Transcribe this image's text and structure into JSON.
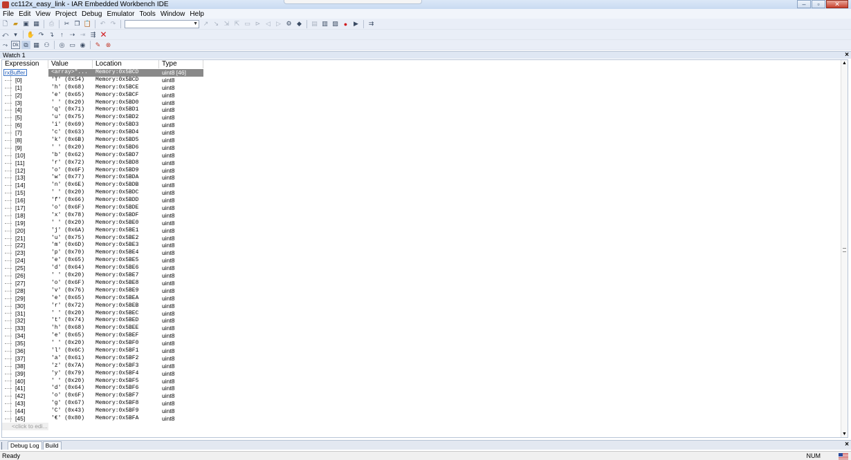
{
  "window": {
    "title": "cc112x_easy_link - IAR Embedded Workbench IDE"
  },
  "menu": [
    "File",
    "Edit",
    "View",
    "Project",
    "Debug",
    "Emulator",
    "Tools",
    "Window",
    "Help"
  ],
  "watch": {
    "title": "Watch 1",
    "columns": [
      "Expression",
      "Value",
      "Location",
      "Type"
    ],
    "root": {
      "expression": "rxBuffer",
      "value": "<array>\"...",
      "location": "Memory:0x5BCD",
      "type": "uint8 [46]"
    },
    "rows": [
      {
        "i": "[0]",
        "v": "'T' (0x54)",
        "l": "Memory:0x5BCD",
        "t": "uint8"
      },
      {
        "i": "[1]",
        "v": "'h' (0x68)",
        "l": "Memory:0x5BCE",
        "t": "uint8"
      },
      {
        "i": "[2]",
        "v": "'e' (0x65)",
        "l": "Memory:0x5BCF",
        "t": "uint8"
      },
      {
        "i": "[3]",
        "v": "' ' (0x20)",
        "l": "Memory:0x5BD0",
        "t": "uint8"
      },
      {
        "i": "[4]",
        "v": "'q' (0x71)",
        "l": "Memory:0x5BD1",
        "t": "uint8"
      },
      {
        "i": "[5]",
        "v": "'u' (0x75)",
        "l": "Memory:0x5BD2",
        "t": "uint8"
      },
      {
        "i": "[6]",
        "v": "'i' (0x69)",
        "l": "Memory:0x5BD3",
        "t": "uint8"
      },
      {
        "i": "[7]",
        "v": "'c' (0x63)",
        "l": "Memory:0x5BD4",
        "t": "uint8"
      },
      {
        "i": "[8]",
        "v": "'k' (0x6B)",
        "l": "Memory:0x5BD5",
        "t": "uint8"
      },
      {
        "i": "[9]",
        "v": "' ' (0x20)",
        "l": "Memory:0x5BD6",
        "t": "uint8"
      },
      {
        "i": "[10]",
        "v": "'b' (0x62)",
        "l": "Memory:0x5BD7",
        "t": "uint8"
      },
      {
        "i": "[11]",
        "v": "'r' (0x72)",
        "l": "Memory:0x5BD8",
        "t": "uint8"
      },
      {
        "i": "[12]",
        "v": "'o' (0x6F)",
        "l": "Memory:0x5BD9",
        "t": "uint8"
      },
      {
        "i": "[13]",
        "v": "'w' (0x77)",
        "l": "Memory:0x5BDA",
        "t": "uint8"
      },
      {
        "i": "[14]",
        "v": "'n' (0x6E)",
        "l": "Memory:0x5BDB",
        "t": "uint8"
      },
      {
        "i": "[15]",
        "v": "' ' (0x20)",
        "l": "Memory:0x5BDC",
        "t": "uint8"
      },
      {
        "i": "[16]",
        "v": "'f' (0x66)",
        "l": "Memory:0x5BDD",
        "t": "uint8"
      },
      {
        "i": "[17]",
        "v": "'o' (0x6F)",
        "l": "Memory:0x5BDE",
        "t": "uint8"
      },
      {
        "i": "[18]",
        "v": "'x' (0x78)",
        "l": "Memory:0x5BDF",
        "t": "uint8"
      },
      {
        "i": "[19]",
        "v": "' ' (0x20)",
        "l": "Memory:0x5BE0",
        "t": "uint8"
      },
      {
        "i": "[20]",
        "v": "'j' (0x6A)",
        "l": "Memory:0x5BE1",
        "t": "uint8"
      },
      {
        "i": "[21]",
        "v": "'u' (0x75)",
        "l": "Memory:0x5BE2",
        "t": "uint8"
      },
      {
        "i": "[22]",
        "v": "'m' (0x6D)",
        "l": "Memory:0x5BE3",
        "t": "uint8"
      },
      {
        "i": "[23]",
        "v": "'p' (0x70)",
        "l": "Memory:0x5BE4",
        "t": "uint8"
      },
      {
        "i": "[24]",
        "v": "'e' (0x65)",
        "l": "Memory:0x5BE5",
        "t": "uint8"
      },
      {
        "i": "[25]",
        "v": "'d' (0x64)",
        "l": "Memory:0x5BE6",
        "t": "uint8"
      },
      {
        "i": "[26]",
        "v": "' ' (0x20)",
        "l": "Memory:0x5BE7",
        "t": "uint8"
      },
      {
        "i": "[27]",
        "v": "'o' (0x6F)",
        "l": "Memory:0x5BE8",
        "t": "uint8"
      },
      {
        "i": "[28]",
        "v": "'v' (0x76)",
        "l": "Memory:0x5BE9",
        "t": "uint8"
      },
      {
        "i": "[29]",
        "v": "'e' (0x65)",
        "l": "Memory:0x5BEA",
        "t": "uint8"
      },
      {
        "i": "[30]",
        "v": "'r' (0x72)",
        "l": "Memory:0x5BEB",
        "t": "uint8"
      },
      {
        "i": "[31]",
        "v": "' ' (0x20)",
        "l": "Memory:0x5BEC",
        "t": "uint8"
      },
      {
        "i": "[32]",
        "v": "'t' (0x74)",
        "l": "Memory:0x5BED",
        "t": "uint8"
      },
      {
        "i": "[33]",
        "v": "'h' (0x68)",
        "l": "Memory:0x5BEE",
        "t": "uint8"
      },
      {
        "i": "[34]",
        "v": "'e' (0x65)",
        "l": "Memory:0x5BEF",
        "t": "uint8"
      },
      {
        "i": "[35]",
        "v": "' ' (0x20)",
        "l": "Memory:0x5BF0",
        "t": "uint8"
      },
      {
        "i": "[36]",
        "v": "'l' (0x6C)",
        "l": "Memory:0x5BF1",
        "t": "uint8"
      },
      {
        "i": "[37]",
        "v": "'a' (0x61)",
        "l": "Memory:0x5BF2",
        "t": "uint8"
      },
      {
        "i": "[38]",
        "v": "'z' (0x7A)",
        "l": "Memory:0x5BF3",
        "t": "uint8"
      },
      {
        "i": "[39]",
        "v": "'y' (0x79)",
        "l": "Memory:0x5BF4",
        "t": "uint8"
      },
      {
        "i": "[40]",
        "v": "' ' (0x20)",
        "l": "Memory:0x5BF5",
        "t": "uint8"
      },
      {
        "i": "[41]",
        "v": "'d' (0x64)",
        "l": "Memory:0x5BF6",
        "t": "uint8"
      },
      {
        "i": "[42]",
        "v": "'o' (0x6F)",
        "l": "Memory:0x5BF7",
        "t": "uint8"
      },
      {
        "i": "[43]",
        "v": "'g' (0x67)",
        "l": "Memory:0x5BF8",
        "t": "uint8"
      },
      {
        "i": "[44]",
        "v": "'C' (0x43)",
        "l": "Memory:0x5BF9",
        "t": "uint8"
      },
      {
        "i": "[45]",
        "v": "'€' (0x80)",
        "l": "Memory:0x5BFA",
        "t": "uint8"
      }
    ],
    "add_row": "<click to edi..."
  },
  "bottom_tabs": [
    "Debug Log",
    "Build"
  ],
  "status": {
    "left": "Ready",
    "num": "NUM"
  },
  "icons": {
    "toolbar1": [
      "new-file-icon",
      "open-icon",
      "save-icon",
      "save-all-icon",
      "print-icon",
      "cut-icon",
      "copy-icon",
      "paste-icon",
      "undo-icon",
      "redo-icon"
    ],
    "colors": {
      "selected_row": "#898989",
      "close_red": "#d0161a"
    }
  }
}
